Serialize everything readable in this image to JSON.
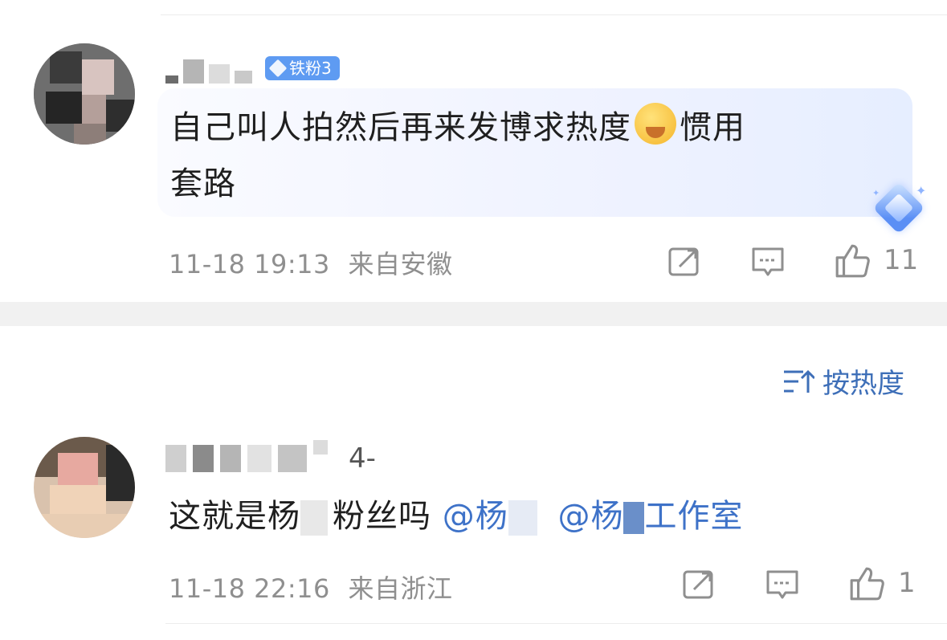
{
  "comments": [
    {
      "badge": "铁粉3",
      "text_before_emoji": "自己叫人拍然后再来发博求热度",
      "emoji": "crying-face-emoji",
      "text_after_emoji_line1": "惯用",
      "text_line2": "套路",
      "date": "11-18 19:13",
      "location": "来自安徽",
      "likes": "11"
    },
    {
      "name_visible": "4-",
      "text_part1": "这就是杨",
      "text_part2": "粉丝吗",
      "mention1": "@杨",
      "mention2_prefix": "@杨",
      "mention2_suffix": "工作室",
      "date": "11-18 22:16",
      "location": "来自浙江",
      "likes": "1"
    }
  ],
  "sort": {
    "label": "按热度",
    "icon": "sort-icon"
  },
  "icons": {
    "share": "share-icon",
    "reply": "comment-icon",
    "like": "thumbs-up-icon"
  },
  "colors": {
    "mention": "#3e72c8",
    "meta": "#8f8f8f",
    "badge": "#5e9bf2",
    "sort": "#3e6fb8"
  }
}
